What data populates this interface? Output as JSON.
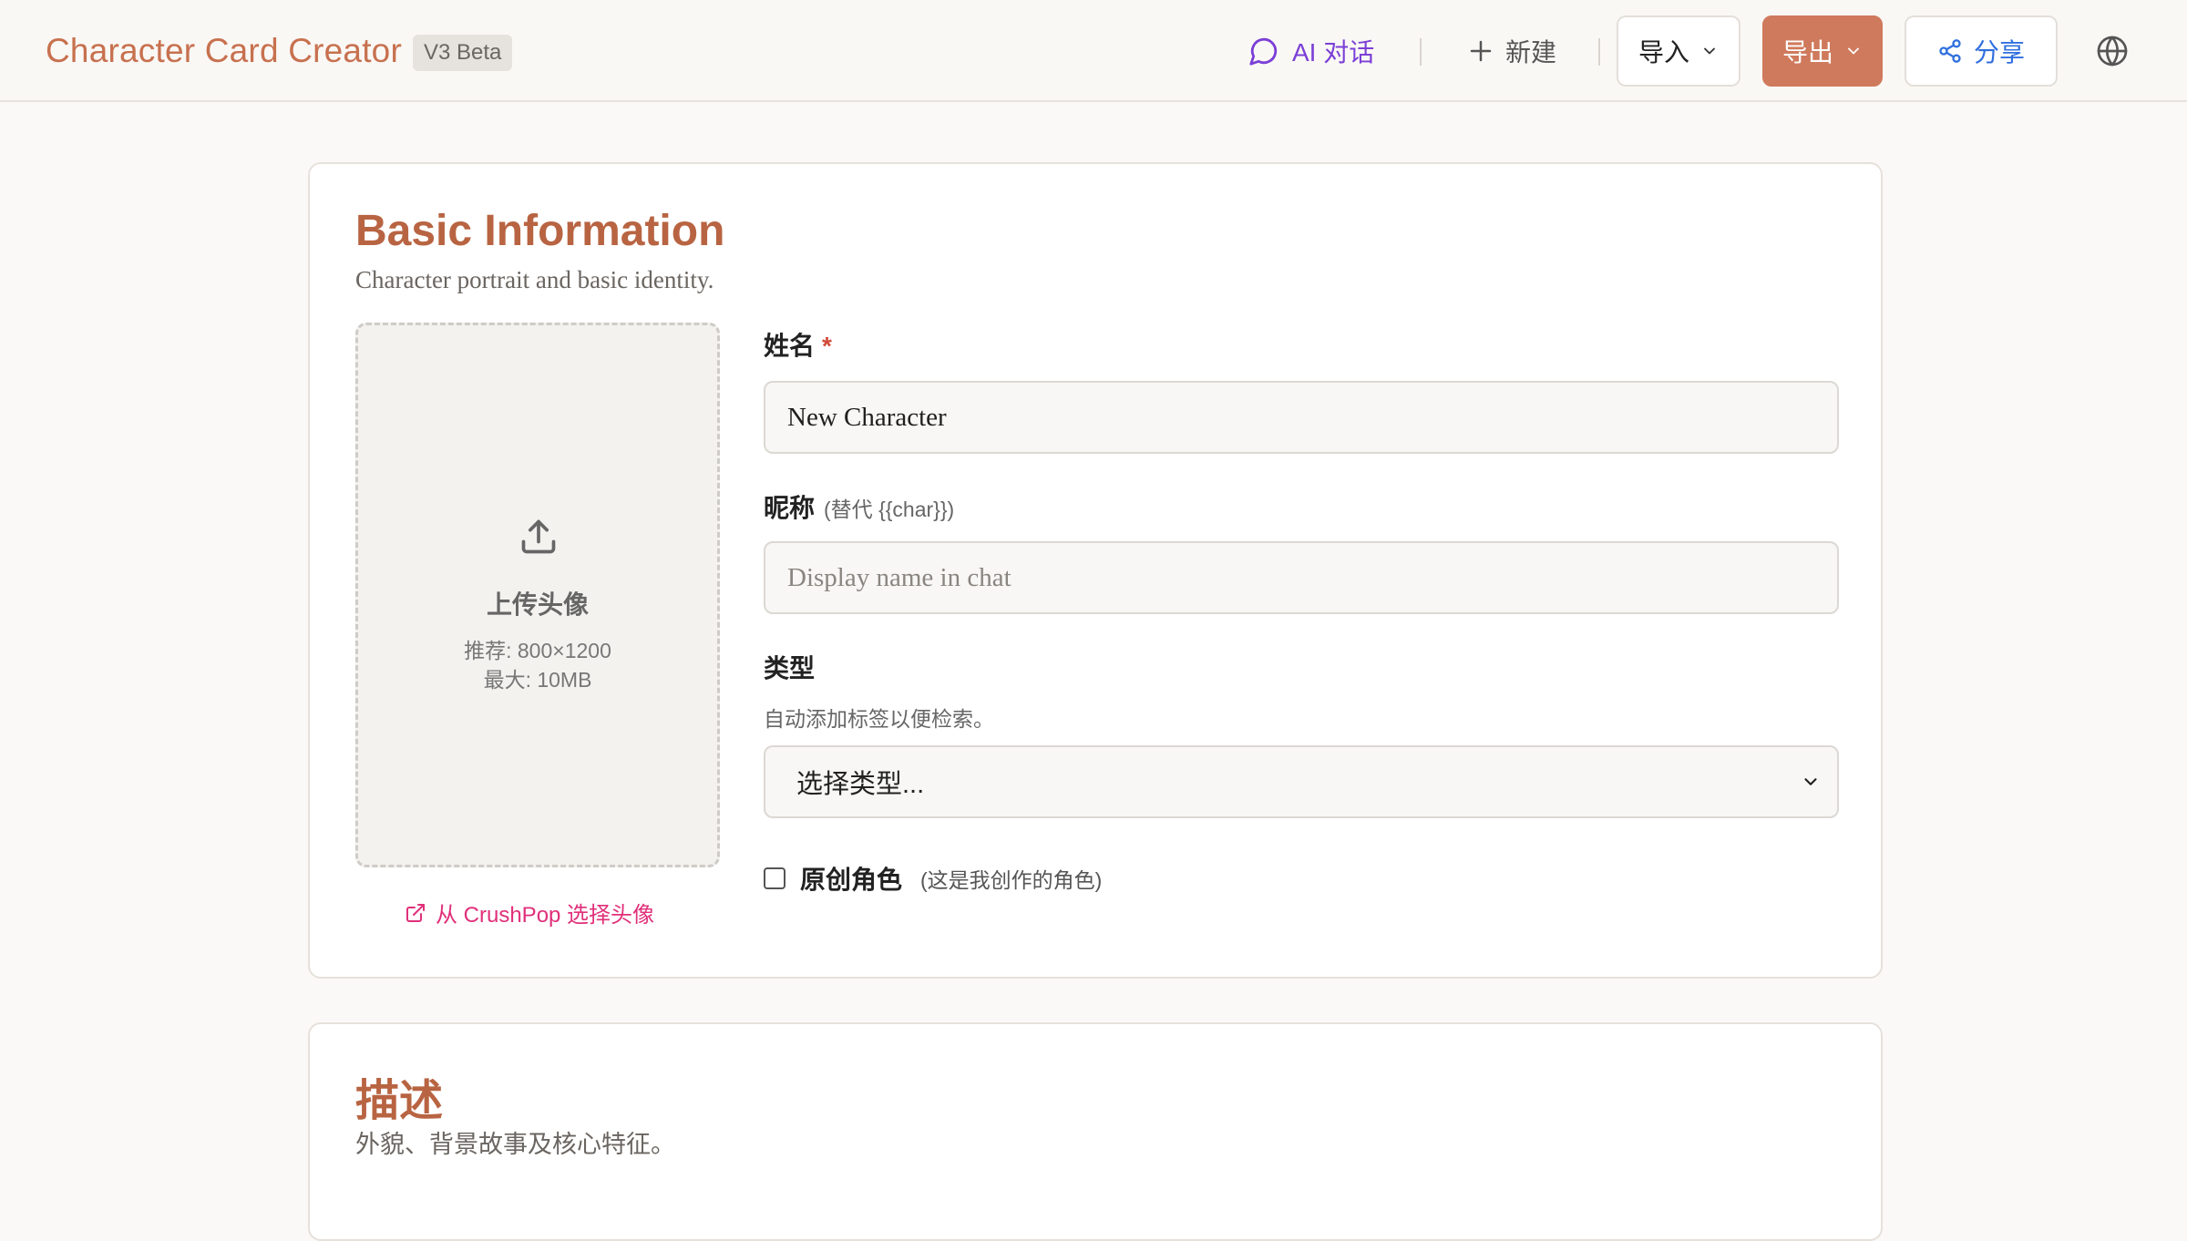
{
  "header": {
    "title": "Character Card Creator",
    "version": "V3 Beta",
    "ai_chat": "AI 对话",
    "new": "新建",
    "import": "导入",
    "export": "导出",
    "share": "分享",
    "colors": {
      "brand": "#c7714f",
      "export_bg": "#cf7a5c",
      "ai": "#7b3fd6",
      "share": "#2f6fde"
    }
  },
  "basic": {
    "title": "Basic Information",
    "subtitle": "Character portrait and basic identity.",
    "upload": {
      "label": "上传头像",
      "hint_recommend": "推荐: 800×1200",
      "hint_max": "最大: 10MB",
      "crushpop_link": "从 CrushPop 选择头像"
    },
    "name": {
      "label": "姓名",
      "required": "*",
      "value": "New Character"
    },
    "nickname": {
      "label": "昵称",
      "note": "(替代 {{char}})",
      "placeholder": "Display name in chat"
    },
    "type": {
      "label": "类型",
      "description": "自动添加标签以便检索。",
      "selected": "选择类型..."
    },
    "original": {
      "label": "原创角色",
      "note": "(这是我创作的角色)"
    }
  },
  "description": {
    "title": "描述",
    "subtitle": "外貌、背景故事及核心特征。"
  }
}
